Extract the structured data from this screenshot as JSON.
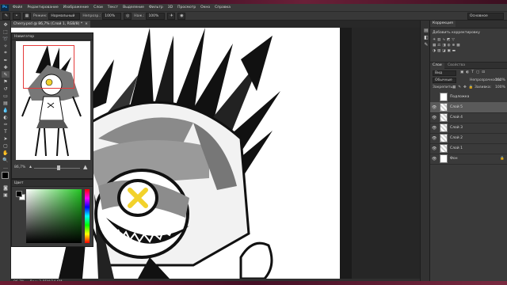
{
  "menu": {
    "app_logo": "Ps",
    "items": [
      "Файл",
      "Редактирование",
      "Изображение",
      "Слои",
      "Текст",
      "Выделение",
      "Фильтр",
      "3D",
      "Просмотр",
      "Окно",
      "Справка"
    ]
  },
  "options": {
    "mode_label": "Режим:",
    "mode_value": "Нормальный",
    "opacity_label": "Непрозр.:",
    "opacity_value": "100%",
    "flow_label": "Наж.:",
    "flow_value": "100%",
    "workspace_value": "Основное"
  },
  "document": {
    "tab_title": "Cherry.psd @ 86,7% (Слой 1, RGB/8) *"
  },
  "status": {
    "zoom": "86,7%",
    "info": "Док: 2,85M/34,6M"
  },
  "navigator": {
    "title": "Навигатор",
    "zoom": "86,7%"
  },
  "color": {
    "title": "Цвет",
    "fg": "#000000",
    "bg": "#ffffff"
  },
  "right": {
    "corrections_tab": "Коррекция",
    "corrections_subtitle": "Добавить корректировку",
    "layers_tabs": [
      "Слои",
      "Свойства"
    ],
    "kind_label": "Вид",
    "blend_mode": "Обычные",
    "opacity_label": "Непрозрачность:",
    "opacity_value": "100%",
    "lock_label": "Закрепить:",
    "fill_label": "Заливка:",
    "fill_value": "100%",
    "layers": [
      {
        "name": "Подложка",
        "visible": true,
        "selected": false
      },
      {
        "name": "Слой 5",
        "visible": true,
        "selected": true
      },
      {
        "name": "Слой 4",
        "visible": true,
        "selected": false
      },
      {
        "name": "Слой 3",
        "visible": true,
        "selected": false
      },
      {
        "name": "Слой 2",
        "visible": true,
        "selected": false
      },
      {
        "name": "Слой 1",
        "visible": true,
        "selected": false
      },
      {
        "name": "Фон",
        "visible": true,
        "selected": false
      }
    ]
  },
  "accent": "#31a8ff",
  "artwork": {
    "x_mark_color": "#f2d22b"
  }
}
